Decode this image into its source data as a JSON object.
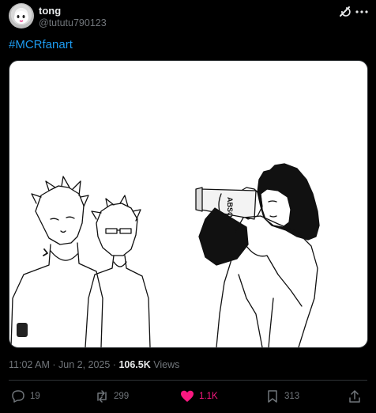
{
  "author": {
    "name": "tong",
    "handle": "@tututu790123"
  },
  "post": {
    "hashtag": "#MCRfanart",
    "timestamp": "11:02 AM · Jun 2, 2025 · ",
    "views_count": "106.5K",
    "views_label": "Views",
    "bottle_text": "ABSOLUT VODKA"
  },
  "actions": {
    "replies": "19",
    "reposts": "299",
    "likes": "1.1K",
    "bookmarks": "313"
  },
  "colors": {
    "link": "#1d9bf0",
    "like": "#f91880",
    "muted": "#71767b"
  }
}
